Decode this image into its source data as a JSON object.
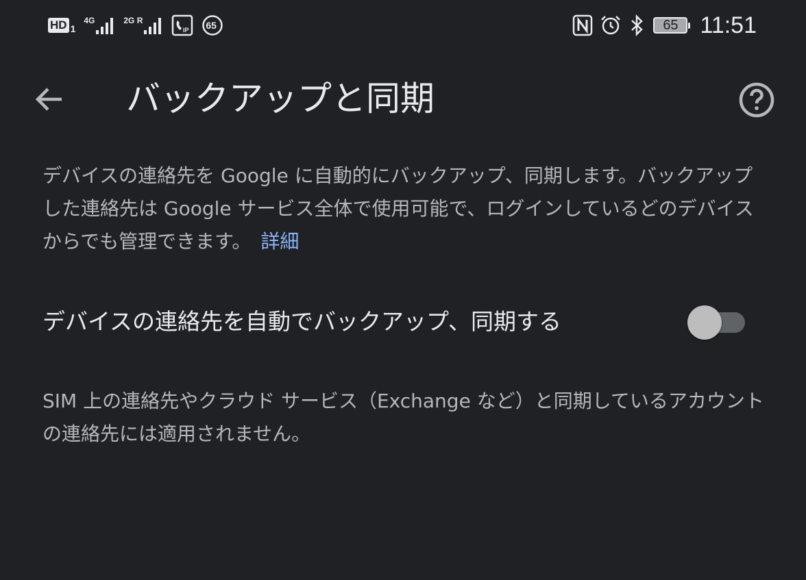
{
  "status_bar": {
    "hd_label": "HD",
    "hd_sub": "1",
    "sim1_label": "4G",
    "sim2_label": "2G R",
    "notification_badge": "65",
    "battery_level": "65",
    "time": "11:51",
    "icons": [
      "hd-icon",
      "signal-4g-icon",
      "signal-2g-roaming-icon",
      "call-ip-icon",
      "notification-count-icon",
      "nfc-icon",
      "alarm-icon",
      "bluetooth-icon",
      "battery-icon"
    ]
  },
  "app_bar": {
    "title": "バックアップと同期",
    "back_icon": "arrow-back-icon",
    "help_icon": "help-circle-icon"
  },
  "description": {
    "text": "デバイスの連絡先を Google に自動的にバックアップ、同期します。バックアップした連絡先は Google サービス全体で使用可能で、ログインしているどのデバイスからでも管理できます。",
    "link_label": "詳細"
  },
  "setting": {
    "label": "デバイスの連絡先を自動でバックアップ、同期する",
    "enabled": false
  },
  "footnote": {
    "text": "SIM 上の連絡先やクラウド サービス（Exchange など）と同期しているアカウントの連絡先には適用されません。"
  },
  "colors": {
    "background": "#202125",
    "primary_text": "#e8eaed",
    "secondary_text": "#b5b7bb",
    "link": "#8ab4f8"
  }
}
